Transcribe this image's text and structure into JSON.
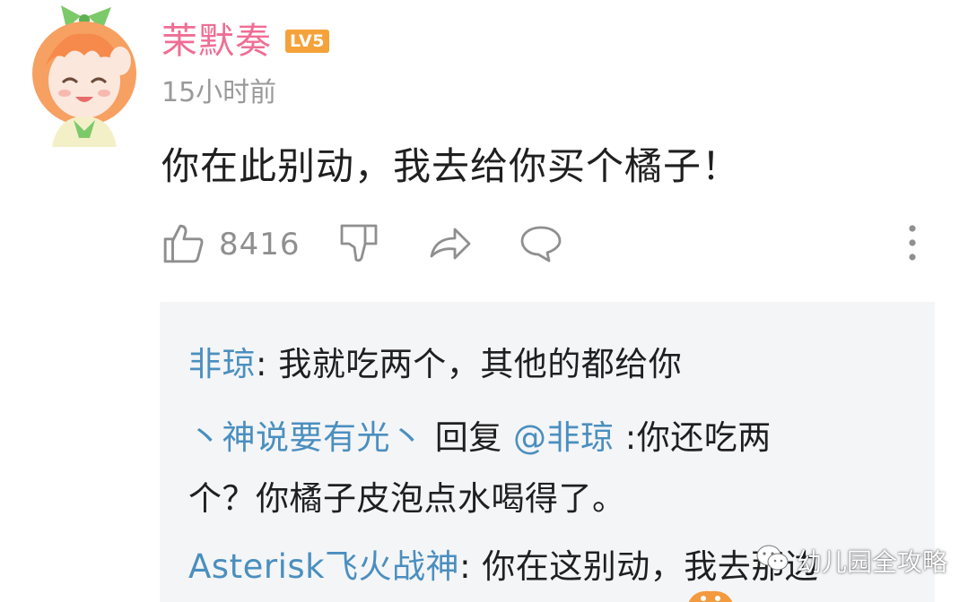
{
  "comment": {
    "username": "茉默奏",
    "level_badge": "LV5",
    "timestamp": "15小时前",
    "text": "你在此别动，我去给你买个橘子！",
    "like_count": "8416"
  },
  "icons": {
    "like": "thumbs-up-icon",
    "dislike": "thumbs-down-icon",
    "share": "share-arrow-icon",
    "reply": "speech-bubble-icon",
    "more": "more-vertical-icon"
  },
  "replies": [
    {
      "user": "非琼",
      "separator": ": ",
      "text": "我就吃两个，其他的都给你"
    },
    {
      "user": "丶神说要有光丶",
      "reply_word": " 回复 ",
      "mention": "@非琼",
      "text_line1": " :你还吃两",
      "text_line2": "个？你橘子皮泡点水喝得了。"
    },
    {
      "user": "Asterisk飞火战神",
      "separator": ": ",
      "text": "你在这别动，我去那边"
    }
  ],
  "watermark": {
    "text": "幼儿园全攻略"
  },
  "colors": {
    "username": "#f06d94",
    "level_badge": "#f5a23a",
    "link": "#4a8fbf",
    "icon_gray": "#8f8f8f",
    "reply_bg": "#f4f5f7"
  }
}
